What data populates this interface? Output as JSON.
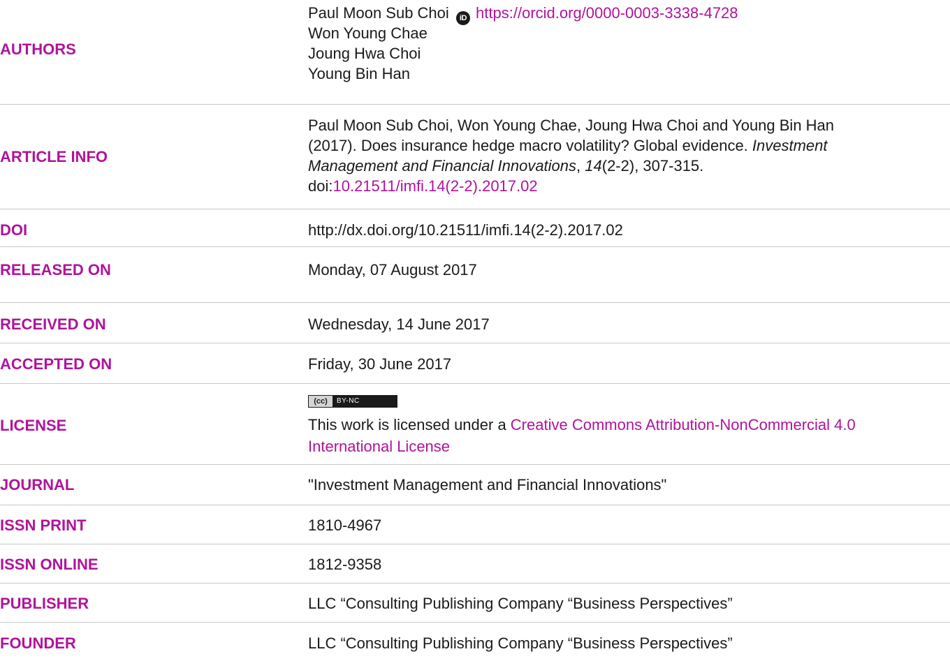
{
  "authors": {
    "label": "AUTHORS",
    "list": [
      {
        "name": "Paul Moon Sub Choi",
        "orcid_url": "https://orcid.org/0000-0003-3338-4728"
      },
      {
        "name": "Won Young Chae"
      },
      {
        "name": "Joung Hwa Choi"
      },
      {
        "name": "Young Bin Han"
      }
    ]
  },
  "article_info": {
    "label": "ARTICLE INFO",
    "line1": "Paul Moon Sub Choi, Won Young Chae, Joung Hwa Choi and Young Bin Han",
    "line2_plain": "(2017). Does insurance hedge macro volatility? Global evidence. ",
    "line2_italic": "Investment",
    "line3_italic": "Management and Financial Innovations",
    "line3_sep": ", ",
    "line3_vol": "14",
    "line3_rest": "(2-2), 307-315.",
    "line4_prefix": "doi:",
    "line4_link": "10.21511/imfi.14(2-2).2017.02"
  },
  "doi": {
    "label": "DOI",
    "value": "http://dx.doi.org/10.21511/imfi.14(2-2).2017.02"
  },
  "released_on": {
    "label": "RELEASED ON",
    "value": "Monday, 07 August 2017"
  },
  "received_on": {
    "label": "RECEIVED ON",
    "value": "Wednesday, 14 June 2017"
  },
  "accepted_on": {
    "label": "ACCEPTED ON",
    "value": "Friday, 30 June 2017"
  },
  "license": {
    "label": "LICENSE",
    "badge_cc": "(cc)",
    "badge_text": "BY-NC",
    "text_prefix": "This work is licensed under a ",
    "link_line1": "Creative Commons Attribution-NonCommercial 4.0",
    "link_line2": "International License"
  },
  "journal": {
    "label": "JOURNAL",
    "value": "\"Investment Management and Financial Innovations\""
  },
  "issn_print": {
    "label": "ISSN PRINT",
    "value": "1810-4967"
  },
  "issn_online": {
    "label": "ISSN ONLINE",
    "value": "1812-9358"
  },
  "publisher": {
    "label": "PUBLISHER",
    "value": "LLC “Consulting Publishing Company “Business Perspectives”"
  },
  "founder": {
    "label": "FOUNDER",
    "value": "LLC “Consulting Publishing Company “Business Perspectives”"
  },
  "colors": {
    "accent": "#b0139b",
    "text": "#1a1a1a",
    "divider": "#c8c8c8"
  }
}
